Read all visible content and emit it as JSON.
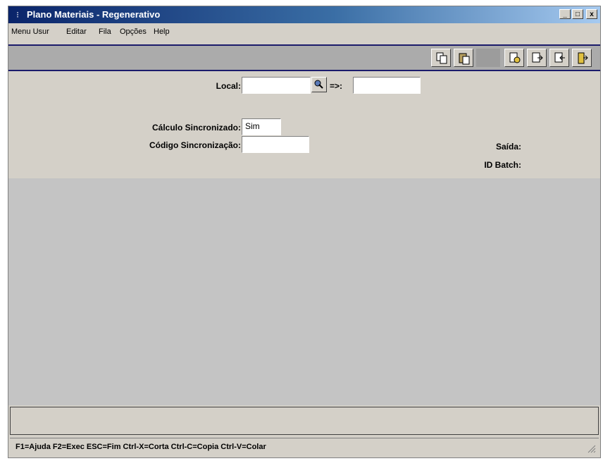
{
  "window": {
    "title": "Plano Materiais - Regenerativo",
    "controls": {
      "minimize": "_",
      "maximize": "□",
      "close": "x"
    }
  },
  "menu": {
    "items": [
      "Menu Usur",
      "Editar",
      "Fila",
      "Opções",
      "Help"
    ]
  },
  "toolbar": {
    "icons": [
      "copy-icon",
      "paste-icon",
      "find-icon",
      "export-icon",
      "import-icon",
      "exit-icon"
    ]
  },
  "form": {
    "local_label": "Local:",
    "local_value": "",
    "arrow_label": "=>:",
    "local_to_value": "",
    "calc_sync_label": "Cálculo Sincronizado:",
    "calc_sync_value": "Sim",
    "sync_code_label": "Código Sincronização:",
    "sync_code_value": "",
    "saida_label": "Saída:",
    "id_batch_label": "ID Batch:"
  },
  "status": {
    "text": "F1=Ajuda F2=Exec ESC=Fim Ctrl-X=Corta Ctrl-C=Copia Ctrl-V=Colar"
  }
}
